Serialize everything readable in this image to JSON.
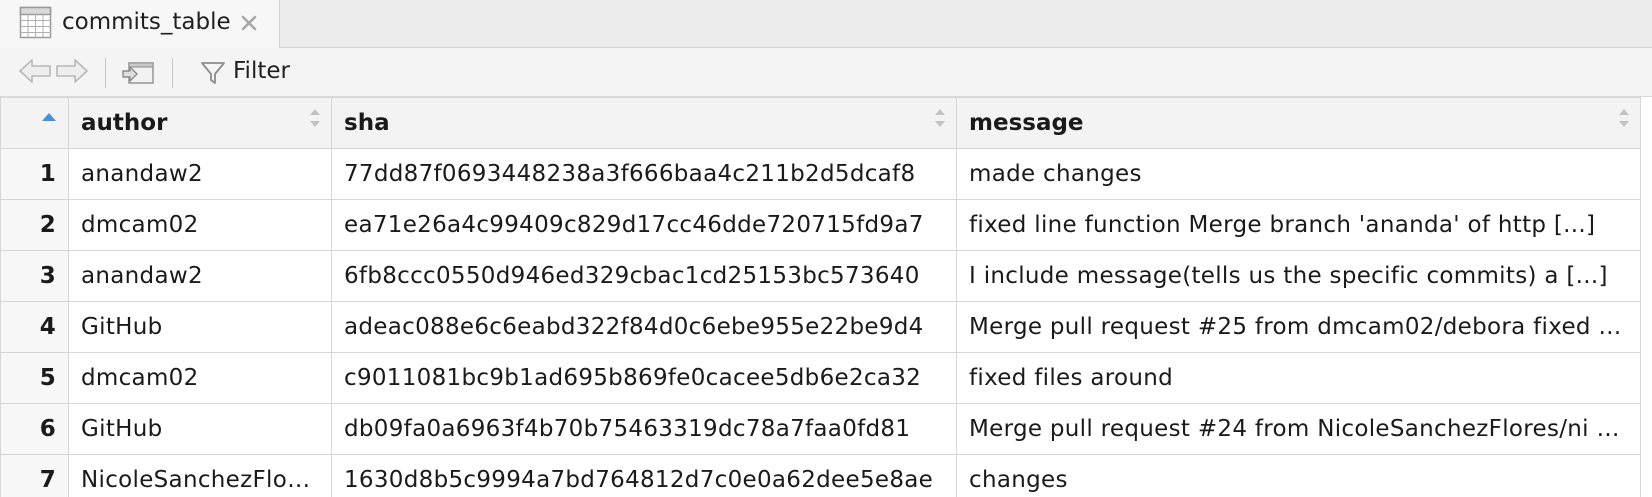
{
  "tab": {
    "title": "commits_table",
    "icon": "table-icon",
    "close_icon": "close-icon"
  },
  "toolbar": {
    "back_icon": "arrow-left-icon",
    "forward_icon": "arrow-right-icon",
    "popout_icon": "show-in-window-icon",
    "filter_icon": "funnel-icon",
    "filter_label": "Filter"
  },
  "table": {
    "columns": [
      "author",
      "sha",
      "message"
    ],
    "rows": [
      {
        "num": "1",
        "author": "anandaw2",
        "sha": "77dd87f0693448238a3f666baa4c211b2d5dcaf8",
        "message": "made changes"
      },
      {
        "num": "2",
        "author": "dmcam02",
        "sha": "ea71e26a4c99409c829d17cc46dde720715fd9a7",
        "message": "fixed line function Merge branch 'ananda' of http [...]"
      },
      {
        "num": "3",
        "author": "anandaw2",
        "sha": "6fb8ccc0550d946ed329cbac1cd25153bc573640",
        "message": "I include message(tells us the specific commits) a [...]"
      },
      {
        "num": "4",
        "author": "GitHub",
        "sha": "adeac088e6c6eabd322f84d0c6ebe955e22be9d4",
        "message": "Merge pull request #25 from dmcam02/debora fixed …"
      },
      {
        "num": "5",
        "author": "dmcam02",
        "sha": "c9011081bc9b1ad695b869fe0cacee5db6e2ca32",
        "message": "fixed files around"
      },
      {
        "num": "6",
        "author": "GitHub",
        "sha": "db09fa0a6963f4b70b75463319dc78a7faa0fd81",
        "message": "Merge pull request #24 from NicoleSanchezFlores/ni […"
      },
      {
        "num": "7",
        "author": "NicoleSanchezFlores",
        "sha": "1630d8b5c9994a7bd764812d7c0e0a62dee5e8ae",
        "message": "changes"
      }
    ]
  },
  "colors": {
    "sort_accent": "#4a90d9",
    "border": "#d6d6d6",
    "header_bg": "#f3f3f3"
  }
}
